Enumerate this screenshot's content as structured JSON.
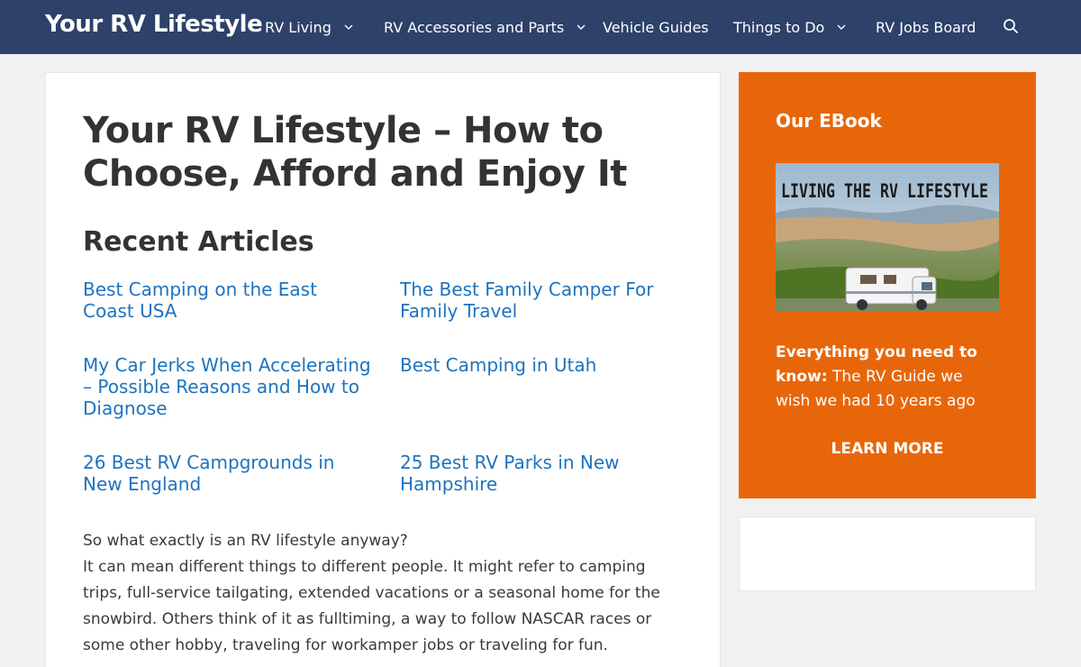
{
  "header": {
    "brand": "Your RV Lifestyle",
    "nav": [
      {
        "label": "RV Living",
        "dropdown": true
      },
      {
        "label": "RV Accessories and Parts",
        "dropdown": true
      },
      {
        "label": "Vehicle Guides",
        "dropdown": false
      },
      {
        "label": "Things to Do",
        "dropdown": true
      },
      {
        "label": "RV Jobs Board",
        "dropdown": false
      }
    ],
    "search_icon": "search-icon"
  },
  "main": {
    "title": "Your RV Lifestyle – How to Choose, Afford and Enjoy It",
    "recent_heading": "Recent Articles",
    "articles": [
      "Best Camping on the East Coast USA",
      "The Best Family Camper For Family Travel",
      "My Car Jerks When Accelerating – Possible Reasons and How to Diagnose",
      "Best Camping in Utah",
      "26 Best RV Campgrounds in New England",
      "25 Best RV Parks in New Hampshire"
    ],
    "intro_question": "So what exactly is an RV lifestyle anyway?",
    "intro_paragraph": "It can mean different things to different people. It might refer to camping trips, full-service tailgating, extended vacations or a seasonal home for the snowbird.  Others think of it as fulltiming, a way to follow NASCAR races or some other hobby, traveling for workamper jobs or traveling for fun."
  },
  "sidebar": {
    "ebook_title": "Our EBook",
    "image_caption": "LIVING THE RV LIFESTYLE",
    "desc_bold": "Everything you need to know:",
    "desc_rest": " The RV Guide we wish we had 10 years ago",
    "cta": "LEARN MORE"
  },
  "colors": {
    "header_bg": "#2d4169",
    "link": "#1e73be",
    "ebook_bg": "#e8660a"
  }
}
